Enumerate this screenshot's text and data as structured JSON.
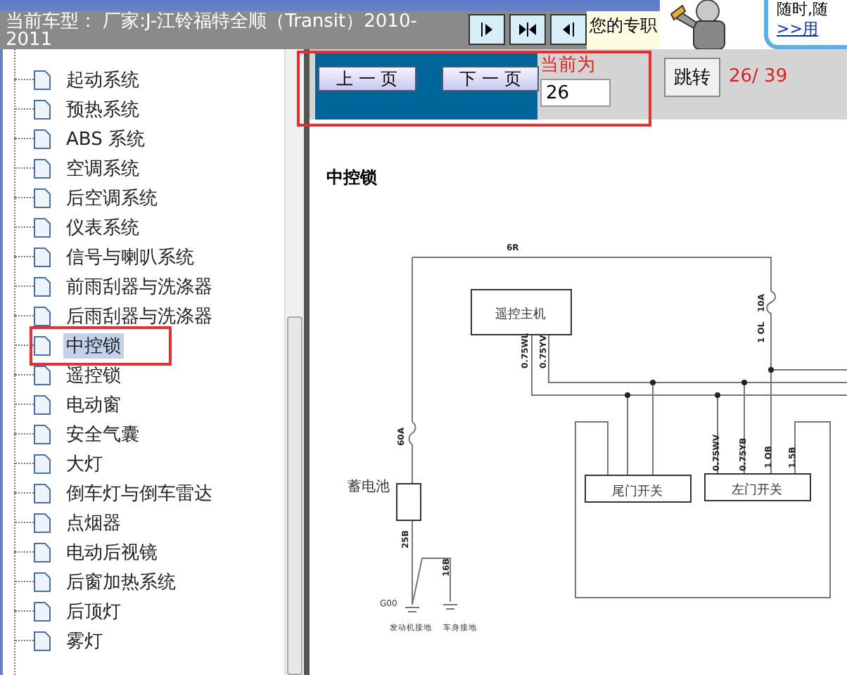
{
  "header": {
    "vehicle": "当前车型： 厂家:J-江铃福特全顺（Transit）2010-2011",
    "promo_text": "您的专职",
    "promo_box_text": "随时,随",
    "promo_link": ">>用"
  },
  "tree": {
    "items": [
      {
        "label": "起动系统",
        "selected": false
      },
      {
        "label": "预热系统",
        "selected": false
      },
      {
        "label": "ABS 系统",
        "selected": false
      },
      {
        "label": "空调系统",
        "selected": false
      },
      {
        "label": "后空调系统",
        "selected": false
      },
      {
        "label": "仪表系统",
        "selected": false
      },
      {
        "label": "信号与喇叭系统",
        "selected": false
      },
      {
        "label": "前雨刮器与洗涤器",
        "selected": false
      },
      {
        "label": "后雨刮器与洗涤器",
        "selected": false
      },
      {
        "label": "中控锁",
        "selected": true
      },
      {
        "label": "遥控锁",
        "selected": false
      },
      {
        "label": "电动窗",
        "selected": false
      },
      {
        "label": "安全气囊",
        "selected": false
      },
      {
        "label": "大灯",
        "selected": false
      },
      {
        "label": "倒车灯与倒车雷达",
        "selected": false
      },
      {
        "label": "点烟器",
        "selected": false
      },
      {
        "label": "电动后视镜",
        "selected": false
      },
      {
        "label": "后窗加热系统",
        "selected": false
      },
      {
        "label": "后顶灯",
        "selected": false
      },
      {
        "label": "雾灯",
        "selected": false
      }
    ]
  },
  "pager": {
    "prev": "上 一 页",
    "next": "下 一 页",
    "current_label": "当前为",
    "page_input": "26",
    "jump": "跳转",
    "page_count": "26/ 39"
  },
  "content": {
    "heading": "中控锁",
    "diagram": {
      "components": [
        "遥控主机",
        "蓄电池",
        "尾门开关",
        "左门开关"
      ],
      "wire_labels": [
        "6R",
        "1 OL",
        "10A",
        "0.75WL",
        "0.75YV",
        "60A",
        "25B",
        "16B",
        "0.75WV",
        "0.75YB",
        "1 OB",
        "1.5B"
      ],
      "ground_labels": [
        "G00",
        "发动机接地",
        "车身接地"
      ]
    }
  }
}
